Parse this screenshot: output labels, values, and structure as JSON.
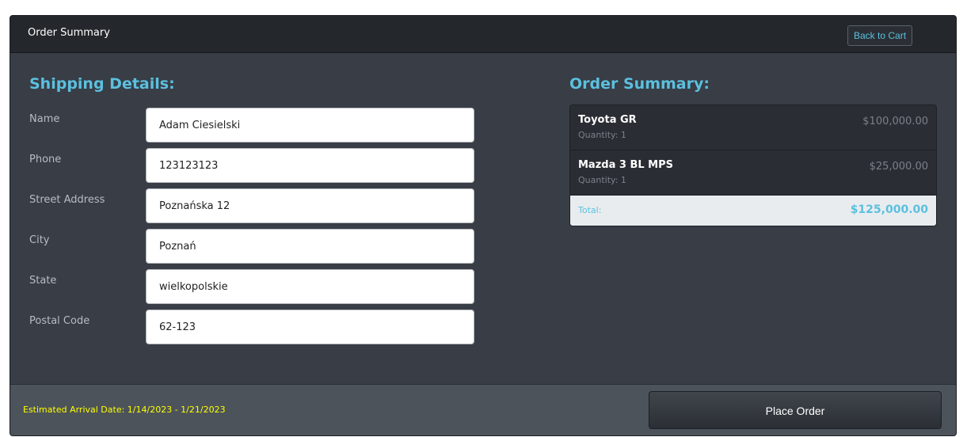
{
  "header": {
    "title": "Order Summary",
    "back_button": "Back to Cart"
  },
  "shipping": {
    "heading": "Shipping Details:",
    "fields": [
      {
        "label": "Name",
        "value": "Adam Ciesielski"
      },
      {
        "label": "Phone",
        "value": "123123123"
      },
      {
        "label": "Street Address",
        "value": "Poznańska 12"
      },
      {
        "label": "City",
        "value": "Poznań"
      },
      {
        "label": "State",
        "value": "wielkopolskie"
      },
      {
        "label": "Postal Code",
        "value": "62-123"
      }
    ]
  },
  "summary": {
    "heading": "Order Summary:",
    "items": [
      {
        "name": "Toyota GR",
        "quantity": "Quantity: 1",
        "price": "$100,000.00"
      },
      {
        "name": "Mazda 3 BL MPS",
        "quantity": "Quantity: 1",
        "price": "$25,000.00"
      }
    ],
    "total_label": "Total:",
    "total_value": "$125,000.00"
  },
  "footer": {
    "arrival": "Estimated Arrival Date: 1/14/2023 - 1/21/2023",
    "place_order": "Place Order"
  },
  "colors": {
    "accent": "#5bc0de",
    "panel": "#383d46",
    "header": "#24272c",
    "footer": "#4c535b",
    "arrival_text": "#ffff00"
  }
}
